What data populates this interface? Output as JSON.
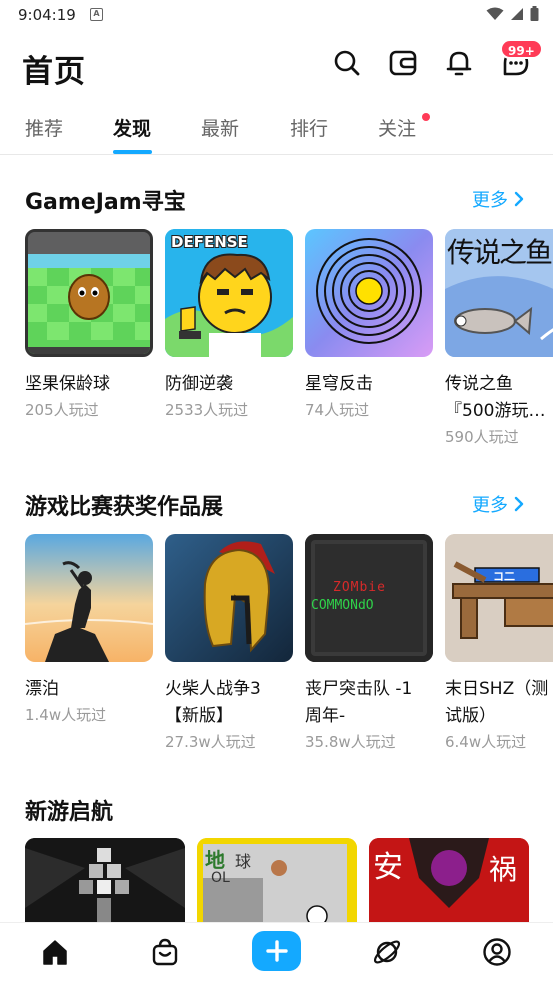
{
  "status_bar": {
    "time": "9:04:19",
    "a_icon_text": "A",
    "icons": [
      "wifi-icon",
      "signal-icon",
      "battery-icon"
    ]
  },
  "header": {
    "title": "首页",
    "icons": [
      "search-icon",
      "wallet-icon",
      "bell-icon",
      "message-icon"
    ],
    "badge": "99+"
  },
  "tabs": [
    {
      "label": "推荐",
      "active": false
    },
    {
      "label": "发现",
      "active": true
    },
    {
      "label": "最新",
      "active": false
    },
    {
      "label": "排行",
      "active": false
    },
    {
      "label": "关注",
      "active": false,
      "has_dot": true
    }
  ],
  "sections": [
    {
      "title": "GameJam寻宝",
      "more": "更多",
      "games": [
        {
          "title": "坚果保龄球",
          "plays": "205人玩过"
        },
        {
          "title": "防御逆袭",
          "plays": "2533人玩过"
        },
        {
          "title": "星穹反击",
          "plays": "74人玩过"
        },
        {
          "title": "传说之鱼『500游玩…",
          "plays": "590人玩过"
        }
      ]
    },
    {
      "title": "游戏比赛获奖作品展",
      "more": "更多",
      "games": [
        {
          "title": "漂泊",
          "plays": "1.4w人玩过"
        },
        {
          "title": "火柴人战争3【新版】",
          "plays": "27.3w人玩过"
        },
        {
          "title": "丧尸突击队 -1周年-",
          "plays": "35.8w人玩过"
        },
        {
          "title": "末日SHZ（测试版）",
          "plays": "6.4w人玩过"
        }
      ]
    },
    {
      "title": "新游启航"
    }
  ],
  "thumb_text": {
    "defense": "DEFENSE",
    "fish": "传说之鱼",
    "zombie_line1": "ZOMbie",
    "zombie_line2": "COMMONdO",
    "shz_sign": "コ二",
    "earth": "地",
    "ball": "球",
    "ol": "OL",
    "an": "安",
    "huo": "祸"
  },
  "bottom_nav": [
    "home-icon",
    "shop-icon",
    "create-icon",
    "planet-icon",
    "profile-icon"
  ],
  "colors": {
    "accent": "#14a9ff",
    "badge": "#ff3b57"
  }
}
